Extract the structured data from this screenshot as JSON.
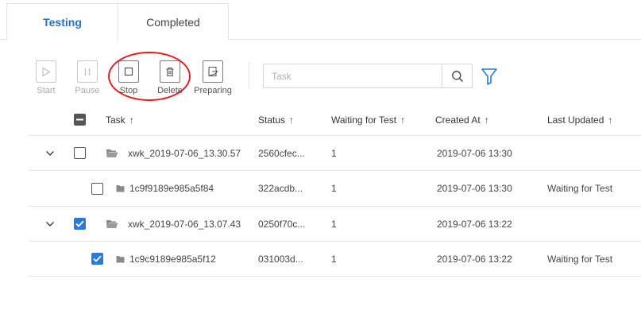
{
  "tabs": [
    {
      "label": "Testing",
      "active": true
    },
    {
      "label": "Completed",
      "active": false
    }
  ],
  "toolbar": {
    "start_label": "Start",
    "pause_label": "Pause",
    "stop_label": "Stop",
    "delete_label": "Delete",
    "preparing_label": "Preparing"
  },
  "search": {
    "placeholder": "Task",
    "value": ""
  },
  "columns": {
    "task": "Task",
    "status": "Status",
    "waiting": "Waiting for Test",
    "created": "Created At",
    "updated": "Last Updated",
    "sort_arrow": "↑"
  },
  "rows": [
    {
      "name": "xwk_2019-07-06_13.30.57",
      "status": "2560cfec...",
      "waiting": "1",
      "created": "2019-07-06 13:30",
      "updated": "",
      "checked": false,
      "kind": "group"
    },
    {
      "name": "1c9f9189e985a5f84",
      "status": "322acdb...",
      "waiting": "1",
      "created": "2019-07-06 13:30",
      "updated": "Waiting for Test",
      "checked": false,
      "kind": "child"
    },
    {
      "name": "xwk_2019-07-06_13.07.43",
      "status": "0250f70c...",
      "waiting": "1",
      "created": "2019-07-06 13:22",
      "updated": "",
      "checked": true,
      "kind": "group"
    },
    {
      "name": "1c9c9189e985a5f12",
      "status": "031003d...",
      "waiting": "1",
      "created": "2019-07-06 13:22",
      "updated": "Waiting for Test",
      "checked": true,
      "kind": "child"
    }
  ],
  "colors": {
    "accent": "#2a6fc6",
    "checkbox_checked": "#2a7ad6",
    "annotation": "#e02020"
  },
  "icons": [
    "play-icon",
    "pause-icon",
    "stop-icon",
    "trash-icon",
    "export-icon",
    "search-icon",
    "filter-icon",
    "chevron-down-icon",
    "folder-open-icon",
    "folder-icon"
  ]
}
